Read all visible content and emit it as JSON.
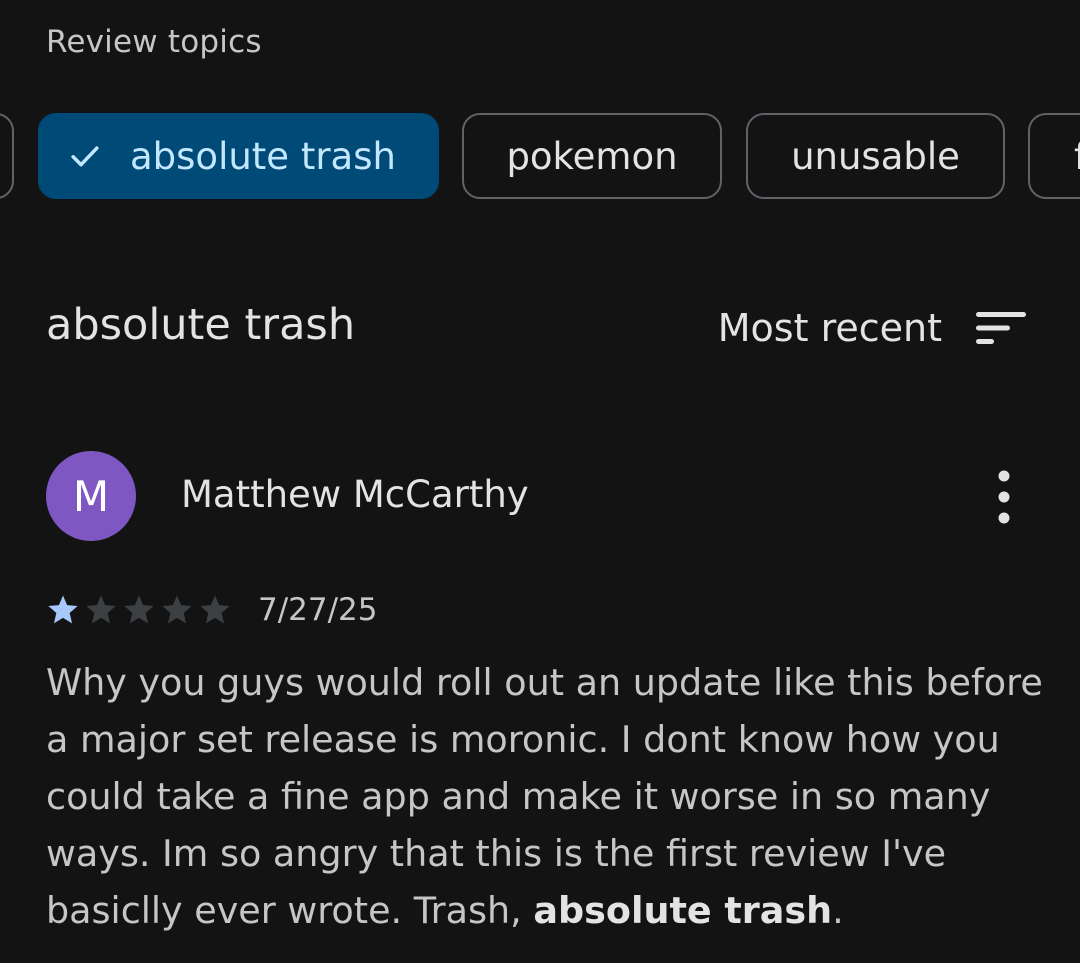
{
  "section": {
    "label": "Review topics"
  },
  "topics": {
    "selected_label": "absolute trash",
    "items": [
      {
        "label": "pokemon"
      },
      {
        "label": "unusable"
      },
      {
        "label": "f"
      }
    ]
  },
  "current_topic": {
    "title": "absolute trash"
  },
  "sort": {
    "label": "Most recent",
    "icon": "sort-icon"
  },
  "review": {
    "avatar_initial": "M",
    "avatar_color": "#7e57c2",
    "author": "Matthew McCarthy",
    "rating": 1,
    "rating_max": 5,
    "date": "7/27/25",
    "body_text": "Why you guys would roll out an update like this before a major set release is moronic. I dont know how you could take a fine app and make it worse in so many ways. Im so angry that this is the first review I've basiclly ever wrote. Trash, ",
    "body_highlight": "absolute trash",
    "body_end": "."
  },
  "colors": {
    "background": "#131314",
    "chip_selected_bg": "#004a77",
    "chip_selected_text": "#c2e7ff",
    "chip_border": "#5f6368",
    "star_filled": "#a8c7fa",
    "star_empty": "#3c4043"
  }
}
